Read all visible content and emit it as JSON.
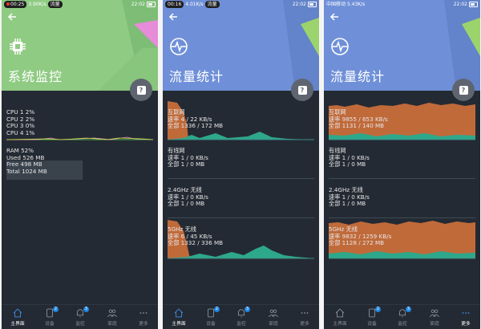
{
  "colors": {
    "cpu_header": "#8fcb83",
    "net_header": "#6f90d8",
    "panel_bg": "#242a33",
    "accent_pink": "#e78cd8",
    "accent_green": "#9bd36c",
    "traffic_fill": "#c06a3a",
    "traffic_teal": "#2ea88a",
    "nav_active": "#3f8de6"
  },
  "phones": [
    {
      "status": {
        "left_pill": "00:25",
        "speed": "3.90K/s",
        "call": "流量",
        "time": "22:02"
      },
      "header": {
        "title": "系统监控",
        "icon": "chip-icon"
      },
      "cpu": {
        "lines": [
          "CPU 1  2%",
          "CPU 2  2%",
          "CPU 3  0%",
          "CPU 4  1%"
        ]
      },
      "ram": {
        "lines": [
          "RAM  52%",
          "Used  526 MB",
          "Free  498 MB",
          "Total  1024 MB"
        ],
        "used_percent": 52
      }
    },
    {
      "status": {
        "left_pill": "00:16",
        "speed": "4.01K/s",
        "call": "流量",
        "time": "22:02"
      },
      "header": {
        "title": "流量统计",
        "icon": "globe-pulse-icon"
      },
      "sections": [
        {
          "name": "互联网",
          "rate": "速率  4 / 22 KB/s",
          "total": "全部  1336 / 172 MB"
        },
        {
          "name": "有线网",
          "rate": "速率  1 / 0 KB/s",
          "total": "全部  1 / 0 MB"
        },
        {
          "name": "2.4GHz 无线",
          "rate": "速率  1 / 0 KB/s",
          "total": "全部  1 / 0 MB"
        },
        {
          "name": "5GHz 无线",
          "rate": "速率  6 / 45 KB/s",
          "total": "全部  1332 / 336 MB"
        }
      ]
    },
    {
      "status": {
        "left_pill": "中国移动",
        "speed": "5.43K/s",
        "call": "",
        "time": "22:02"
      },
      "header": {
        "title": "流量统计",
        "icon": "globe-pulse-icon"
      },
      "sections": [
        {
          "name": "互联网",
          "rate": "速率  9855 / 653 KB/s",
          "total": "全部  1131 / 140 MB"
        },
        {
          "name": "有线网",
          "rate": "速率  1 / 0 KB/s",
          "total": "全部  1 / 0 MB"
        },
        {
          "name": "2.4GHz 无线",
          "rate": "速率  1 / 0 KB/s",
          "total": "全部  1 / 0 MB"
        },
        {
          "name": "5GHz 无线",
          "rate": "速率  9832 / 1259 KB/s",
          "total": "全部  1128 / 272 MB"
        }
      ]
    }
  ],
  "nav": {
    "items": [
      {
        "label": "主界面",
        "icon": "home-icon"
      },
      {
        "label": "设备",
        "icon": "device-icon",
        "badge": "2"
      },
      {
        "label": "监控",
        "icon": "bell-icon",
        "badge": "3"
      },
      {
        "label": "家庭",
        "icon": "family-icon"
      },
      {
        "label": "更多",
        "icon": "more-icon"
      }
    ],
    "active_per_phone": [
      0,
      0,
      4
    ]
  }
}
